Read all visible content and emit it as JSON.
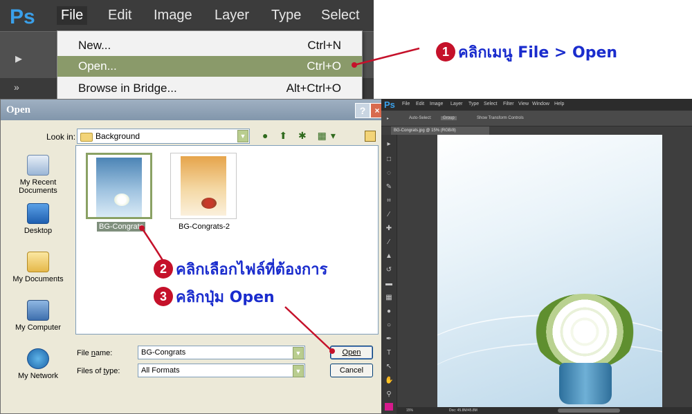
{
  "top_ps": {
    "logo": "Ps",
    "menu": [
      "File",
      "Edit",
      "Image",
      "Layer",
      "Type",
      "Select"
    ],
    "dropdown": [
      {
        "label": "New...",
        "shortcut": "Ctrl+N"
      },
      {
        "label": "Open...",
        "shortcut": "Ctrl+O"
      },
      {
        "label": "Browse in Bridge...",
        "shortcut": "Alt+Ctrl+O"
      }
    ],
    "toolbar_arrow": "▸",
    "panel_collapse": "»"
  },
  "annotations": {
    "step1": {
      "num": "1",
      "text": "คลิกเมนู File > Open"
    },
    "step2": {
      "num": "2",
      "text": "คลิกเลือกไฟล์ที่ต้องการ"
    },
    "step3": {
      "num": "3",
      "text": "คลิกปุ่ม Open"
    },
    "color_text": "#1a2ccd",
    "color_marker": "#c5112a"
  },
  "dialog": {
    "title": "Open",
    "help": "?",
    "close": "×",
    "look_in_label": "Look in:",
    "look_in_value": "Background",
    "nav_icons": "● ⬆ ✱ ▦▾",
    "places": [
      "My Recent Documents",
      "Desktop",
      "My Documents",
      "My Computer",
      "My Network"
    ],
    "files": [
      {
        "name": "BG-Congrats",
        "selected": true
      },
      {
        "name": "BG-Congrats-2",
        "selected": false
      }
    ],
    "file_name_label": "File name:",
    "file_name_value": "BG-Congrats",
    "file_type_label": "Files of type:",
    "file_type_value": "All Formats",
    "open_button": "Open",
    "cancel_button": "Cancel"
  },
  "right_ps": {
    "logo": "Ps",
    "menu": [
      "File",
      "Edit",
      "Image",
      "Layer",
      "Type",
      "Select",
      "Filter",
      "View",
      "Window",
      "Help"
    ],
    "options": [
      "▸",
      "Auto-Select:",
      "Group",
      "Show Transform Controls"
    ],
    "doc_tab": "BG-Congrats.jpg @ 15% (RGB/8)",
    "status_zoom": "15%",
    "status_doc": "Doc: 45.8M/45.8M"
  }
}
